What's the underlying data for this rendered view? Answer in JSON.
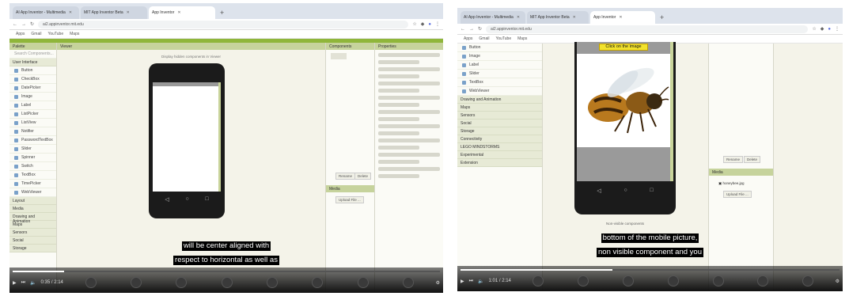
{
  "left": {
    "tabs": [
      {
        "label": "AI App Inventor - Multimedia",
        "active": false
      },
      {
        "label": "MIT App Inventor Beta",
        "active": false
      },
      {
        "label": "App Inventor",
        "active": true
      }
    ],
    "new_tab": "+",
    "address": "ai2.appinventor.mit.edu",
    "bookmarks": [
      "Apps",
      "Gmail",
      "YouTube",
      "Maps"
    ],
    "viewer_title": "Display hidden components in Viewer",
    "palette_header": "Palette",
    "palette_search": "Search Components...",
    "palette_category": "User Interface",
    "palette_items": [
      "Button",
      "CheckBox",
      "DatePicker",
      "Image",
      "Label",
      "ListPicker",
      "ListView",
      "Notifier",
      "PasswordTextBox",
      "Slider",
      "Spinner",
      "Switch",
      "TextBox",
      "TimePicker",
      "WebViewer"
    ],
    "palette_sections": [
      "Layout",
      "Media",
      "Drawing and Animation",
      "Maps",
      "Sensors",
      "Social",
      "Storage"
    ],
    "viewer_header": "Viewer",
    "components_header": "Components",
    "properties_header": "Properties",
    "media_header": "Media",
    "upload_label": "Upload File ...",
    "rename_label": "Rename",
    "delete_label": "Delete",
    "caption": [
      "will be center aligned with",
      "respect to horizontal as well as"
    ],
    "time": "0:35 / 2:14",
    "progress": 0.12
  },
  "right": {
    "tabs": [
      {
        "label": "AI App Inventor - Multimedia",
        "active": false
      },
      {
        "label": "MIT App Inventor Beta",
        "active": false
      },
      {
        "label": "App Inventor",
        "active": true
      }
    ],
    "new_tab": "+",
    "address": "ai2.appinventor.mit.edu",
    "bookmarks": [
      "Apps",
      "Gmail",
      "YouTube",
      "Maps"
    ],
    "palette_items": [
      "Button",
      "Image",
      "Label",
      "Slider",
      "TextBox",
      "WebViewer"
    ],
    "palette_sections": [
      "Drawing and Animation",
      "Maps",
      "Sensors",
      "Social",
      "Storage",
      "Connectivity",
      "LEGO MINDSTORMS",
      "Experimental",
      "Extension"
    ],
    "button_text": "Click on the image",
    "non_visible_label": "Non-visible components",
    "rename_label": "Rename",
    "delete_label": "Delete",
    "media_header": "Media",
    "media_file": "honeybee.jpg",
    "upload_label": "Upload File ...",
    "caption": [
      "bottom of the mobile picture,",
      "non visible component and you"
    ],
    "time": "1:01 / 2:14",
    "progress": 0.4
  },
  "colors": {
    "appinventor_green": "#8fb63a",
    "header_green": "#c6d39c",
    "button_yellow": "#f2e22c"
  },
  "icons": [
    "back-icon",
    "forward-icon",
    "reload-icon",
    "play-icon",
    "next-icon",
    "volume-icon",
    "bee-image",
    "honeybee-image"
  ]
}
